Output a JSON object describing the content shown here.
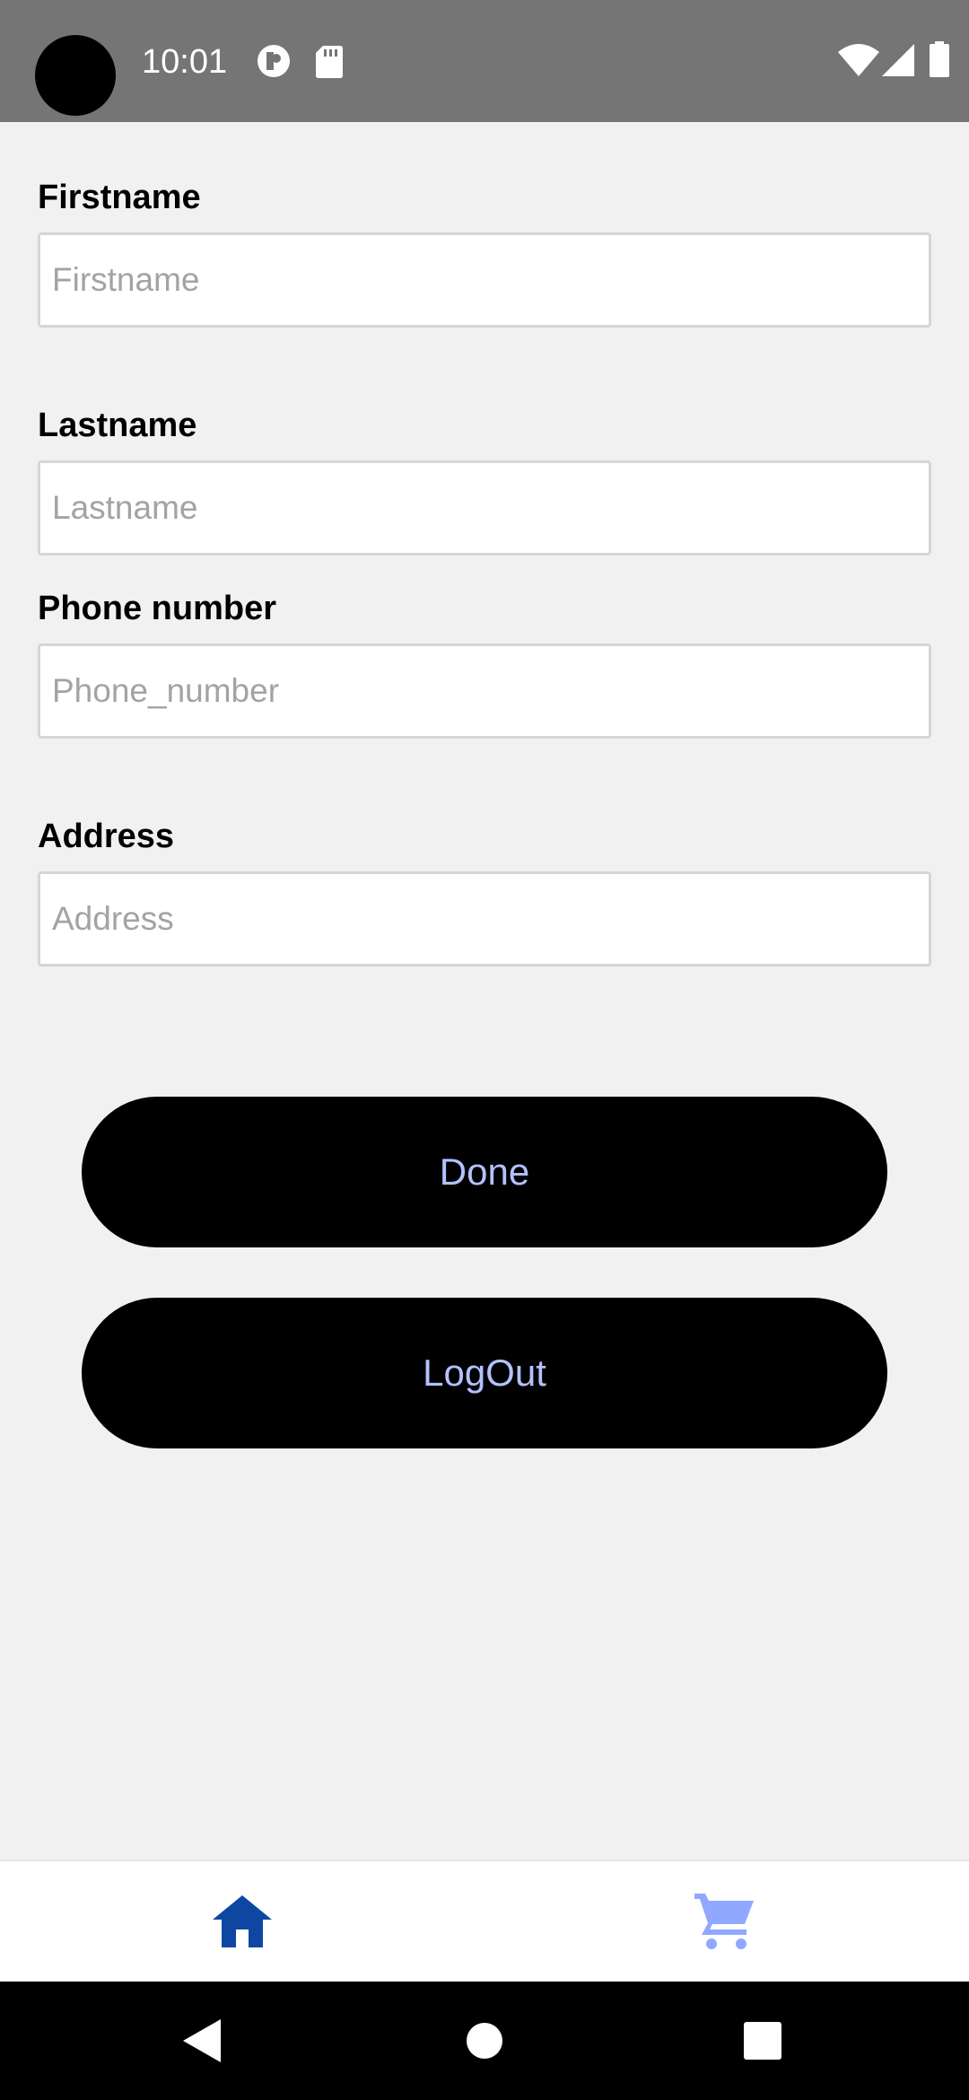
{
  "status_bar": {
    "time": "10:01",
    "icons": [
      "privacy-indicator-icon",
      "sd-card-icon",
      "wifi-icon",
      "cellular-signal-icon",
      "battery-icon"
    ]
  },
  "form": {
    "firstname": {
      "label": "Firstname",
      "placeholder": "Firstname",
      "value": ""
    },
    "lastname": {
      "label": "Lastname",
      "placeholder": "Lastname",
      "value": ""
    },
    "phone": {
      "label": "Phone number",
      "placeholder": "Phone_number",
      "value": ""
    },
    "address": {
      "label": "Address",
      "placeholder": "Address",
      "value": ""
    }
  },
  "buttons": {
    "done": "Done",
    "logout": "LogOut"
  },
  "tab_bar": {
    "tabs": [
      {
        "icon": "home-icon",
        "active": true
      },
      {
        "icon": "cart-icon",
        "active": false
      }
    ]
  },
  "nav_bar": {
    "icons": [
      "back-icon",
      "home-nav-icon",
      "recents-icon"
    ]
  },
  "colors": {
    "status_bar_bg": "#757575",
    "page_bg": "#f1f1f1",
    "button_bg": "#000000",
    "button_text": "#b3c1ff",
    "tab_active": "#0d47a1",
    "tab_inactive": "#90a8ff",
    "placeholder": "#a3a3a3"
  }
}
